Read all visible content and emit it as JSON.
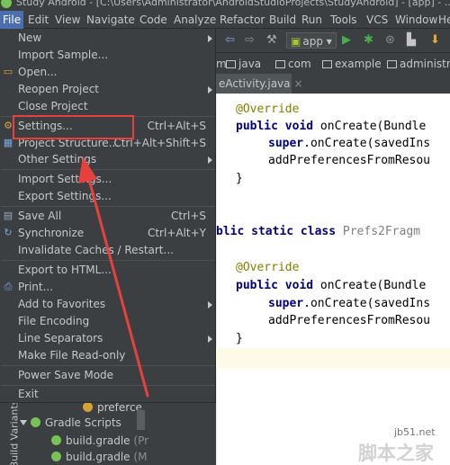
{
  "window": {
    "title": "Study Android - [C:\\Users\\Administrator\\AndroidStudioProjects\\StudyAndroid] - [app] - ...\\app\\"
  },
  "menubar": {
    "items": [
      "File",
      "Edit",
      "View",
      "Navigate",
      "Code",
      "Analyze",
      "Refactor",
      "Build",
      "Run",
      "Tools",
      "VCS",
      "Window",
      "He"
    ],
    "active": "File"
  },
  "toolbar": {
    "run_config": "app",
    "icons": [
      "back-icon",
      "forward-icon",
      "run-icon",
      "debug-icon",
      "stop-icon",
      "sdk-manager-icon"
    ]
  },
  "breadcrumbs": [
    "m",
    "java",
    "com",
    "example",
    "administra"
  ],
  "editor_tab": {
    "label": "eActivity.java",
    "close_glyph": "×"
  },
  "code": {
    "line1": "@Override",
    "line2_kw": "public void",
    "line2_rest": " onCreate(Bundle",
    "line3_kw": "super",
    "line3_rest": ".onCreate(savedIns",
    "line4": "addPreferencesFromResou",
    "line5": "}",
    "line6_a": "blic static class",
    "line6_b": " Prefs2Fragm",
    "line7": "@Override",
    "line8_kw": "public void",
    "line8_rest": " onCreate(Bundle",
    "line9_kw": "super",
    "line9_rest": ".onCreate(savedIns",
    "line10": "addPreferencesFromResou",
    "line11": "}"
  },
  "file_menu": {
    "items": [
      {
        "label": "New",
        "shortcut": "",
        "submenu": true
      },
      {
        "label": "Import Sample...",
        "shortcut": "",
        "submenu": false
      },
      {
        "label": "Open...",
        "shortcut": "",
        "submenu": false
      },
      {
        "label": "Reopen Project",
        "shortcut": "",
        "submenu": true
      },
      {
        "label": "Close Project",
        "shortcut": "",
        "submenu": false
      },
      {
        "label": "Settings...",
        "shortcut": "Ctrl+Alt+S",
        "submenu": false
      },
      {
        "label": "Project Structure...",
        "shortcut": "Ctrl+Alt+Shift+S",
        "submenu": false
      },
      {
        "label": "Other Settings",
        "shortcut": "",
        "submenu": true
      },
      {
        "label": "Import Settings...",
        "shortcut": "",
        "submenu": false
      },
      {
        "label": "Export Settings...",
        "shortcut": "",
        "submenu": false
      },
      {
        "label": "Save All",
        "shortcut": "Ctrl+S",
        "submenu": false
      },
      {
        "label": "Synchronize",
        "shortcut": "Ctrl+Alt+Y",
        "submenu": false
      },
      {
        "label": "Invalidate Caches / Restart...",
        "shortcut": "",
        "submenu": false
      },
      {
        "label": "Export to HTML...",
        "shortcut": "",
        "submenu": false
      },
      {
        "label": "Print...",
        "shortcut": "",
        "submenu": false
      },
      {
        "label": "Add to Favorites",
        "shortcut": "",
        "submenu": true
      },
      {
        "label": "File Encoding",
        "shortcut": "",
        "submenu": false
      },
      {
        "label": "Line Separators",
        "shortcut": "",
        "submenu": true
      },
      {
        "label": "Make File Read-only",
        "shortcut": "",
        "submenu": false
      },
      {
        "label": "Power Save Mode",
        "shortcut": "",
        "submenu": false
      },
      {
        "label": "Exit",
        "shortcut": "",
        "submenu": false
      }
    ]
  },
  "project_panel": {
    "side_label": "Build Variants",
    "partial_item": "preferce",
    "gradle_scripts": "Gradle Scripts",
    "build_gradle_1": "build.gradle",
    "build_gradle_1_suffix": "(Pr",
    "build_gradle_2": "build.gradle",
    "build_gradle_2_suffix": "(M"
  },
  "watermark": {
    "url": "jb51.net",
    "name": "脚本之家"
  },
  "colors": {
    "menu_bg": "#3c3f41",
    "highlight": "#e8413d",
    "selection": "#4b6eaf"
  }
}
